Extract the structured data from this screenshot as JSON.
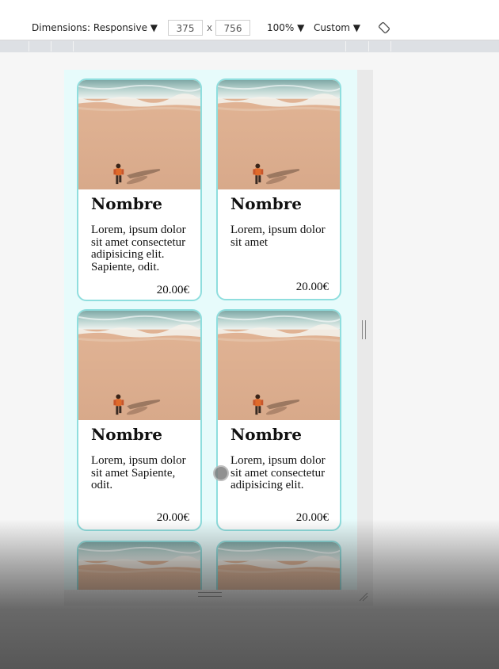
{
  "toolbar": {
    "dimensions_label": "Dimensions: Responsive ▼",
    "width_value": "375",
    "times_sign": "x",
    "height_value": "756",
    "zoom_label": "100% ▼",
    "throttle_label": "Custom ▼",
    "rotate_icon": "rotate-device-icon"
  },
  "cards": [
    {
      "title": "Nombre",
      "description": "Lorem, ipsum dolor sit amet consectetur adipisicing elit. Sapiente, odit.",
      "price": "20.00€"
    },
    {
      "title": "Nombre",
      "description": "Lorem, ipsum dolor sit amet",
      "price": "20.00€"
    },
    {
      "title": "Nombre",
      "description": "Lorem, ipsum dolor sit amet Sapiente, odit.",
      "price": "20.00€"
    },
    {
      "title": "Nombre",
      "description": "Lorem, ipsum dolor sit amet consectetur adipisicing elit.",
      "price": "20.00€"
    }
  ],
  "colors": {
    "card_border": "#8fdede",
    "page_background": "#e7fbfb"
  }
}
